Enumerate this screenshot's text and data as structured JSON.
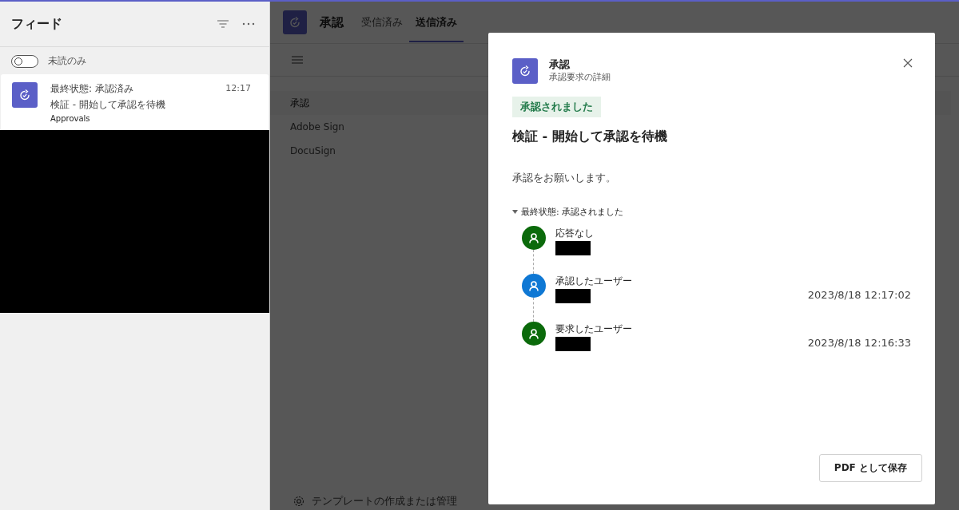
{
  "feed": {
    "title": "フィード",
    "unread_toggle": {
      "label": "未読のみ",
      "on": false
    },
    "items": [
      {
        "title": "最終状態: 承認済み",
        "subtitle": "検証 - 開始して承認を待機",
        "app": "Approvals",
        "time": "12:17",
        "selected": true
      }
    ],
    "redacted_area": true
  },
  "app": {
    "title": "承認",
    "tabs": [
      {
        "label": "受信済み",
        "selected": false
      },
      {
        "label": "送信済み",
        "selected": true
      }
    ],
    "nav": [
      {
        "label": "承認",
        "selected": true
      },
      {
        "label": "Adobe Sign",
        "selected": false
      },
      {
        "label": "DocuSign",
        "selected": false
      }
    ],
    "footer_link": "テンプレートの作成または管理"
  },
  "dialog": {
    "title": "承認",
    "subtitle": "承認要求の詳細",
    "status_badge": "承認されました",
    "heading": "検証 - 開始して承認を待機",
    "message": "承認をお願いします。",
    "history": {
      "label": "最終状態: 承認されました",
      "expanded": true,
      "entries": [
        {
          "label": "応答なし",
          "name_redacted": true,
          "color": "#0b6a0b"
        },
        {
          "label": "承認したユーザー",
          "name_redacted": true,
          "date": "2023/8/18 12:17:02",
          "color": "#0f78d4"
        },
        {
          "label": "要求したユーザー",
          "name_redacted": true,
          "date": "2023/8/18 12:16:33",
          "color": "#0b6a0b"
        }
      ]
    },
    "save_button": "PDF として保存"
  }
}
